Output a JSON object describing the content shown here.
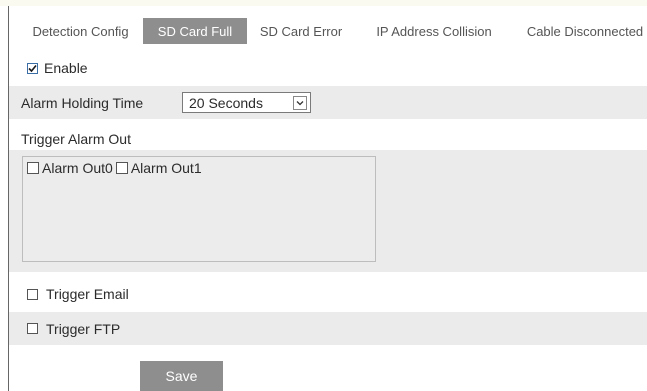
{
  "tabs": [
    {
      "label": "Detection Config",
      "active": false
    },
    {
      "label": "SD Card Full",
      "active": true
    },
    {
      "label": "SD Card Error",
      "active": false
    },
    {
      "label": "IP Address Collision",
      "active": false
    },
    {
      "label": "Cable Disconnected",
      "active": false
    }
  ],
  "enable": {
    "label": "Enable",
    "checked": true
  },
  "alarm_holding_time": {
    "label": "Alarm Holding Time",
    "value": "20 Seconds"
  },
  "trigger_alarm_out": {
    "label": "Trigger Alarm Out",
    "options": [
      {
        "label": "Alarm Out0",
        "checked": false
      },
      {
        "label": "Alarm Out1",
        "checked": false
      }
    ]
  },
  "trigger_email": {
    "label": "Trigger Email",
    "checked": false
  },
  "trigger_ftp": {
    "label": "Trigger FTP",
    "checked": false
  },
  "save_label": "Save",
  "colors": {
    "active_tab": "#8e8e8e",
    "row_gray": "#ebebeb",
    "button": "#8e8e8e"
  }
}
